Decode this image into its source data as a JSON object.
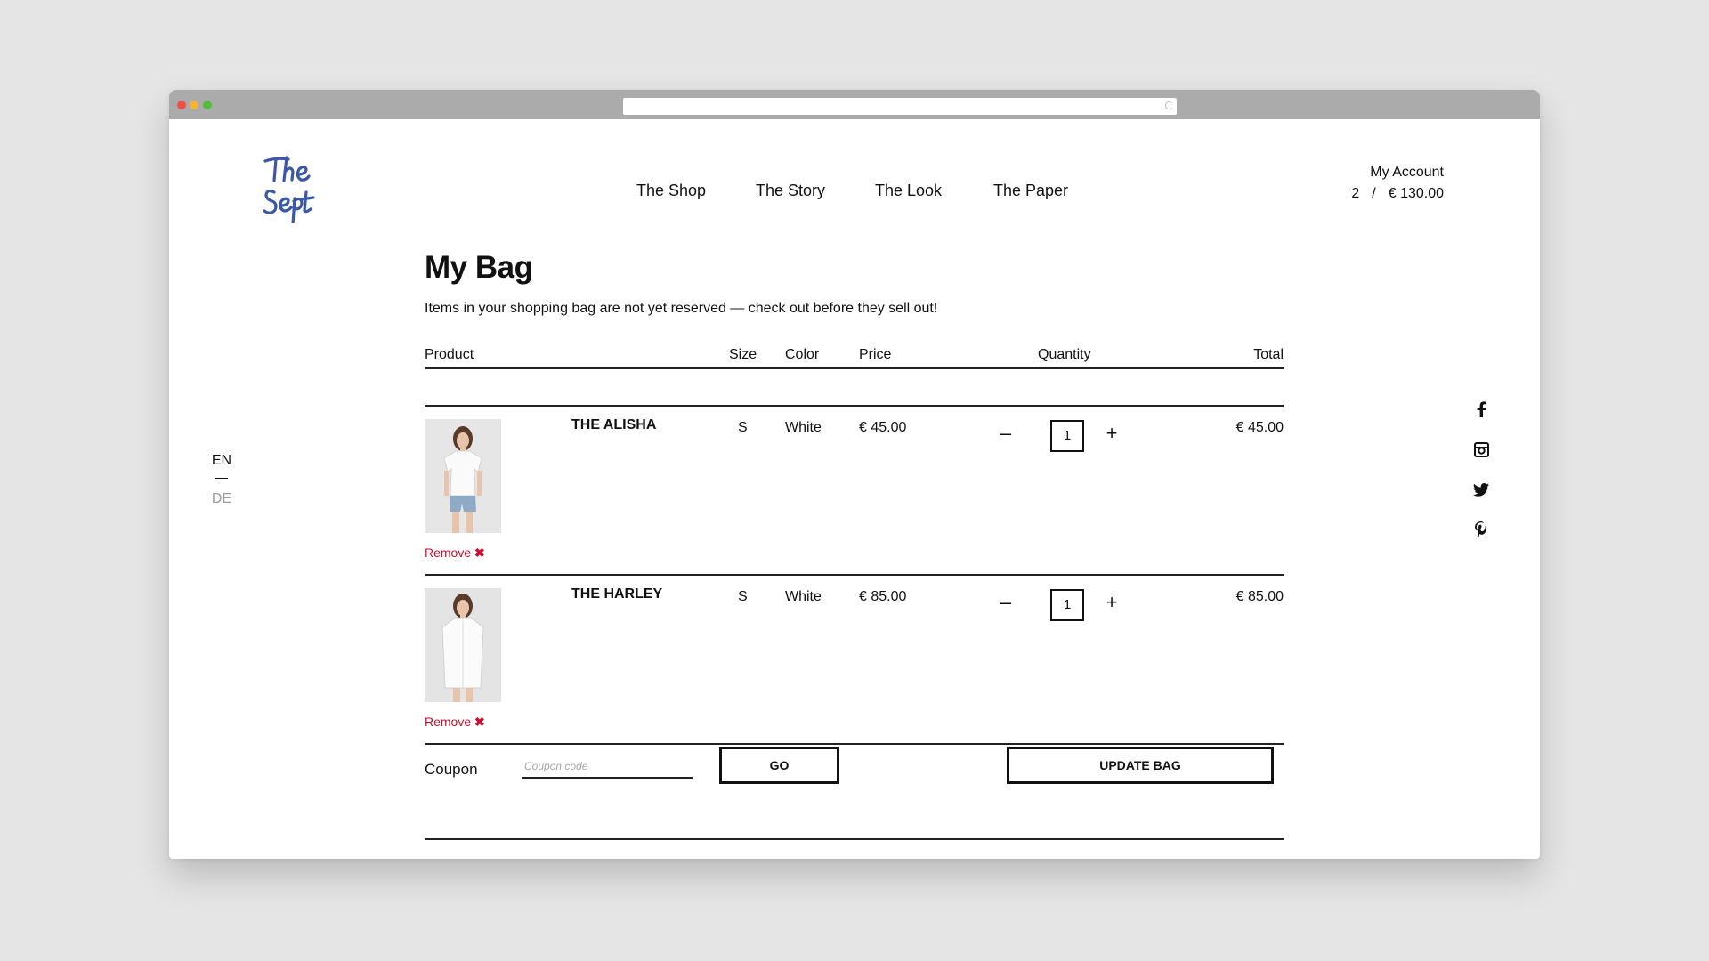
{
  "nav": {
    "items": [
      "The Shop",
      "The Story",
      "The Look",
      "The Paper"
    ]
  },
  "account": {
    "label": "My Account",
    "count": "2",
    "separator": "/",
    "total": "€ 130.00"
  },
  "lang": {
    "active": "EN",
    "other": "DE"
  },
  "social": [
    "facebook-icon",
    "instagram-icon",
    "twitter-icon",
    "pinterest-icon"
  ],
  "page": {
    "title": "My Bag",
    "subtitle": "Items in your shopping bag are not yet reserved — check out before they sell out!"
  },
  "table": {
    "headers": {
      "product": "Product",
      "size": "Size",
      "color": "Color",
      "price": "Price",
      "quantity": "Quantity",
      "total": "Total"
    },
    "rows": [
      {
        "name": "THE ALISHA",
        "size": "S",
        "color": "White",
        "price": "€ 45.00",
        "quantity": "1",
        "total": "€ 45.00",
        "remove": "Remove",
        "qty_minus": "–",
        "qty_plus": "+"
      },
      {
        "name": "THE HARLEY",
        "size": "S",
        "color": "White",
        "price": "€ 85.00",
        "quantity": "1",
        "total": "€ 85.00",
        "remove": "Remove",
        "qty_minus": "–",
        "qty_plus": "+"
      }
    ]
  },
  "coupon": {
    "label": "Coupon",
    "placeholder": "Coupon code",
    "go": "GO",
    "update": "UPDATE BAG"
  },
  "colors": {
    "accent": "#c8102e",
    "logo": "#3a57a8"
  }
}
